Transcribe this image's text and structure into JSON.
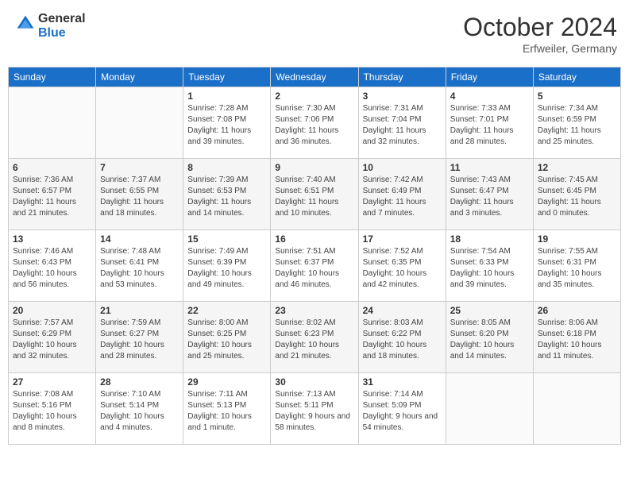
{
  "header": {
    "logo_general": "General",
    "logo_blue": "Blue",
    "month_title": "October 2024",
    "subtitle": "Erfweiler, Germany"
  },
  "days_of_week": [
    "Sunday",
    "Monday",
    "Tuesday",
    "Wednesday",
    "Thursday",
    "Friday",
    "Saturday"
  ],
  "weeks": [
    [
      {
        "day": "",
        "sunrise": "",
        "sunset": "",
        "daylight": ""
      },
      {
        "day": "",
        "sunrise": "",
        "sunset": "",
        "daylight": ""
      },
      {
        "day": "1",
        "sunrise": "Sunrise: 7:28 AM",
        "sunset": "Sunset: 7:08 PM",
        "daylight": "Daylight: 11 hours and 39 minutes."
      },
      {
        "day": "2",
        "sunrise": "Sunrise: 7:30 AM",
        "sunset": "Sunset: 7:06 PM",
        "daylight": "Daylight: 11 hours and 36 minutes."
      },
      {
        "day": "3",
        "sunrise": "Sunrise: 7:31 AM",
        "sunset": "Sunset: 7:04 PM",
        "daylight": "Daylight: 11 hours and 32 minutes."
      },
      {
        "day": "4",
        "sunrise": "Sunrise: 7:33 AM",
        "sunset": "Sunset: 7:01 PM",
        "daylight": "Daylight: 11 hours and 28 minutes."
      },
      {
        "day": "5",
        "sunrise": "Sunrise: 7:34 AM",
        "sunset": "Sunset: 6:59 PM",
        "daylight": "Daylight: 11 hours and 25 minutes."
      }
    ],
    [
      {
        "day": "6",
        "sunrise": "Sunrise: 7:36 AM",
        "sunset": "Sunset: 6:57 PM",
        "daylight": "Daylight: 11 hours and 21 minutes."
      },
      {
        "day": "7",
        "sunrise": "Sunrise: 7:37 AM",
        "sunset": "Sunset: 6:55 PM",
        "daylight": "Daylight: 11 hours and 18 minutes."
      },
      {
        "day": "8",
        "sunrise": "Sunrise: 7:39 AM",
        "sunset": "Sunset: 6:53 PM",
        "daylight": "Daylight: 11 hours and 14 minutes."
      },
      {
        "day": "9",
        "sunrise": "Sunrise: 7:40 AM",
        "sunset": "Sunset: 6:51 PM",
        "daylight": "Daylight: 11 hours and 10 minutes."
      },
      {
        "day": "10",
        "sunrise": "Sunrise: 7:42 AM",
        "sunset": "Sunset: 6:49 PM",
        "daylight": "Daylight: 11 hours and 7 minutes."
      },
      {
        "day": "11",
        "sunrise": "Sunrise: 7:43 AM",
        "sunset": "Sunset: 6:47 PM",
        "daylight": "Daylight: 11 hours and 3 minutes."
      },
      {
        "day": "12",
        "sunrise": "Sunrise: 7:45 AM",
        "sunset": "Sunset: 6:45 PM",
        "daylight": "Daylight: 11 hours and 0 minutes."
      }
    ],
    [
      {
        "day": "13",
        "sunrise": "Sunrise: 7:46 AM",
        "sunset": "Sunset: 6:43 PM",
        "daylight": "Daylight: 10 hours and 56 minutes."
      },
      {
        "day": "14",
        "sunrise": "Sunrise: 7:48 AM",
        "sunset": "Sunset: 6:41 PM",
        "daylight": "Daylight: 10 hours and 53 minutes."
      },
      {
        "day": "15",
        "sunrise": "Sunrise: 7:49 AM",
        "sunset": "Sunset: 6:39 PM",
        "daylight": "Daylight: 10 hours and 49 minutes."
      },
      {
        "day": "16",
        "sunrise": "Sunrise: 7:51 AM",
        "sunset": "Sunset: 6:37 PM",
        "daylight": "Daylight: 10 hours and 46 minutes."
      },
      {
        "day": "17",
        "sunrise": "Sunrise: 7:52 AM",
        "sunset": "Sunset: 6:35 PM",
        "daylight": "Daylight: 10 hours and 42 minutes."
      },
      {
        "day": "18",
        "sunrise": "Sunrise: 7:54 AM",
        "sunset": "Sunset: 6:33 PM",
        "daylight": "Daylight: 10 hours and 39 minutes."
      },
      {
        "day": "19",
        "sunrise": "Sunrise: 7:55 AM",
        "sunset": "Sunset: 6:31 PM",
        "daylight": "Daylight: 10 hours and 35 minutes."
      }
    ],
    [
      {
        "day": "20",
        "sunrise": "Sunrise: 7:57 AM",
        "sunset": "Sunset: 6:29 PM",
        "daylight": "Daylight: 10 hours and 32 minutes."
      },
      {
        "day": "21",
        "sunrise": "Sunrise: 7:59 AM",
        "sunset": "Sunset: 6:27 PM",
        "daylight": "Daylight: 10 hours and 28 minutes."
      },
      {
        "day": "22",
        "sunrise": "Sunrise: 8:00 AM",
        "sunset": "Sunset: 6:25 PM",
        "daylight": "Daylight: 10 hours and 25 minutes."
      },
      {
        "day": "23",
        "sunrise": "Sunrise: 8:02 AM",
        "sunset": "Sunset: 6:23 PM",
        "daylight": "Daylight: 10 hours and 21 minutes."
      },
      {
        "day": "24",
        "sunrise": "Sunrise: 8:03 AM",
        "sunset": "Sunset: 6:22 PM",
        "daylight": "Daylight: 10 hours and 18 minutes."
      },
      {
        "day": "25",
        "sunrise": "Sunrise: 8:05 AM",
        "sunset": "Sunset: 6:20 PM",
        "daylight": "Daylight: 10 hours and 14 minutes."
      },
      {
        "day": "26",
        "sunrise": "Sunrise: 8:06 AM",
        "sunset": "Sunset: 6:18 PM",
        "daylight": "Daylight: 10 hours and 11 minutes."
      }
    ],
    [
      {
        "day": "27",
        "sunrise": "Sunrise: 7:08 AM",
        "sunset": "Sunset: 5:16 PM",
        "daylight": "Daylight: 10 hours and 8 minutes."
      },
      {
        "day": "28",
        "sunrise": "Sunrise: 7:10 AM",
        "sunset": "Sunset: 5:14 PM",
        "daylight": "Daylight: 10 hours and 4 minutes."
      },
      {
        "day": "29",
        "sunrise": "Sunrise: 7:11 AM",
        "sunset": "Sunset: 5:13 PM",
        "daylight": "Daylight: 10 hours and 1 minute."
      },
      {
        "day": "30",
        "sunrise": "Sunrise: 7:13 AM",
        "sunset": "Sunset: 5:11 PM",
        "daylight": "Daylight: 9 hours and 58 minutes."
      },
      {
        "day": "31",
        "sunrise": "Sunrise: 7:14 AM",
        "sunset": "Sunset: 5:09 PM",
        "daylight": "Daylight: 9 hours and 54 minutes."
      },
      {
        "day": "",
        "sunrise": "",
        "sunset": "",
        "daylight": ""
      },
      {
        "day": "",
        "sunrise": "",
        "sunset": "",
        "daylight": ""
      }
    ]
  ]
}
